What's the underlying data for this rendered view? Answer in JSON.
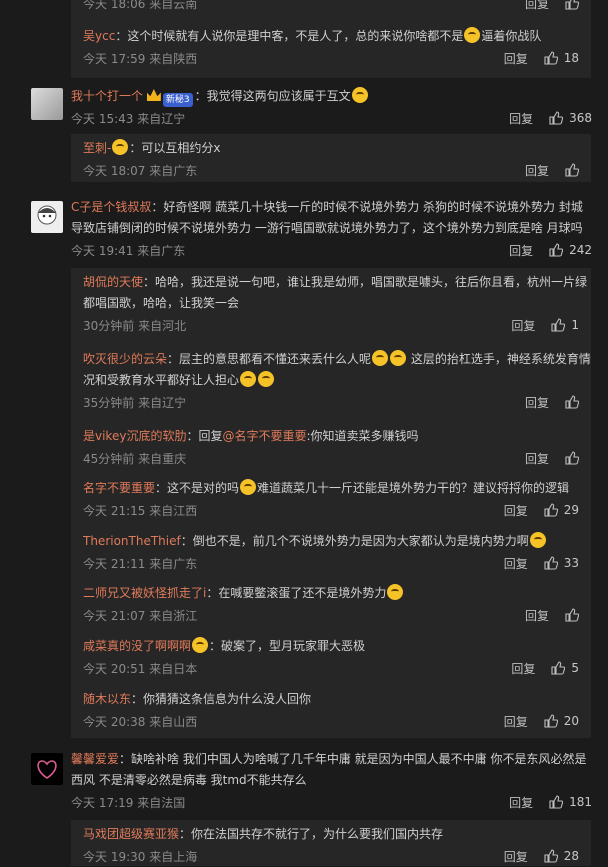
{
  "ui": {
    "reply_label": "回复",
    "like_icon": "thumb-up-icon"
  },
  "c0": {
    "r0": {
      "time": "今天 18:06 来自云南"
    },
    "r1": {
      "name": "吴ycc",
      "pre": "：这个时候就有人说你是理中客，不是人了，总的来说你啥都不是",
      "post": "逼着你战队",
      "time": "今天 17:59 来自陕西",
      "likes": "18"
    }
  },
  "c1": {
    "name": "我十个打一个",
    "badge": "新秘3",
    "text": "：我觉得这两句应该属于互文",
    "time": "今天 15:43 来自辽宁",
    "likes": "368",
    "r0": {
      "name": "至刺-",
      "text": "：可以互相约分x",
      "time": "今天 18:07 来自广东"
    }
  },
  "c2": {
    "name": "C子是个钱叔叔",
    "text": "：好奇怪啊 蔬菜几十块钱一斤的时候不说境外势力 杀狗的时候不说境外势力 封城导致店铺倒闭的时候不说境外势力 一游行唱国歌就说境外势力了，这个境外势力到底是啥 月球吗",
    "time": "今天 19:41 来自广东",
    "likes": "242",
    "r0": {
      "name": "胡侃的天使",
      "text": "：哈哈，我还是说一句吧，谁让我是幼师，唱国歌是噱头，往后你且看，杭州一片绿都唱国歌，哈哈，让我笑一会",
      "time": "30分钟前 来自河北",
      "likes": "1"
    },
    "r1": {
      "name": "吹灭很少的云朵",
      "pre": "：层主的意思都看不懂还来丢什么人呢",
      "mid": "这层的抬杠选手，神经系统发育情况和受教育水平都好让人担心",
      "time": "35分钟前 来自辽宁"
    },
    "r2": {
      "name": "是vikey沉底的软肋",
      "pre": "：回复",
      "mention": "@名字不要重要",
      "post": ":你知道卖菜多赚钱吗",
      "time": "45分钟前 来自重庆"
    },
    "r3": {
      "name": "名字不要重要",
      "pre": "：这不是对的吗",
      "post": "难道蔬菜几十一斤还能是境外势力干的？建议捋捋你的逻辑",
      "time": "今天 21:15 来自江西",
      "likes": "29"
    },
    "r4": {
      "name": "TherionTheThief",
      "text": "：倒也不是，前几个不说境外势力是因为大家都认为是境内势力啊",
      "time": "今天 21:11 来自广东",
      "likes": "33"
    },
    "r5": {
      "name": "二师兄又被妖怪抓走了i",
      "text": "：在喊要鳖滚蛋了还不是境外势力",
      "time": "今天 21:07 来自浙江"
    },
    "r6": {
      "name": "咸菜真的没了啊啊啊",
      "text": "：破案了，型月玩家罪大恶极",
      "time": "今天 20:51 来自日本",
      "likes": "5"
    },
    "r7": {
      "name": "随木以东",
      "text": "：你猜猜这条信息为什么没人回你",
      "time": "今天 20:38 来自山西",
      "likes": "20"
    }
  },
  "c3": {
    "name": "馨馨爱爱",
    "text": "：缺啥补啥 我们中国人为啥喊了几千年中庸 就是因为中国人最不中庸 你不是东风必然是西风 不是清零必然是病毒 我tmd不能共存么",
    "time": "今天 17:19 来自法国",
    "likes": "181",
    "r0": {
      "name": "马戏团超级赛亚猴",
      "text": "：你在法国共存不就行了，为什么要我们国内共存",
      "time": "今天 19:30 来自上海",
      "likes": "28"
    }
  }
}
